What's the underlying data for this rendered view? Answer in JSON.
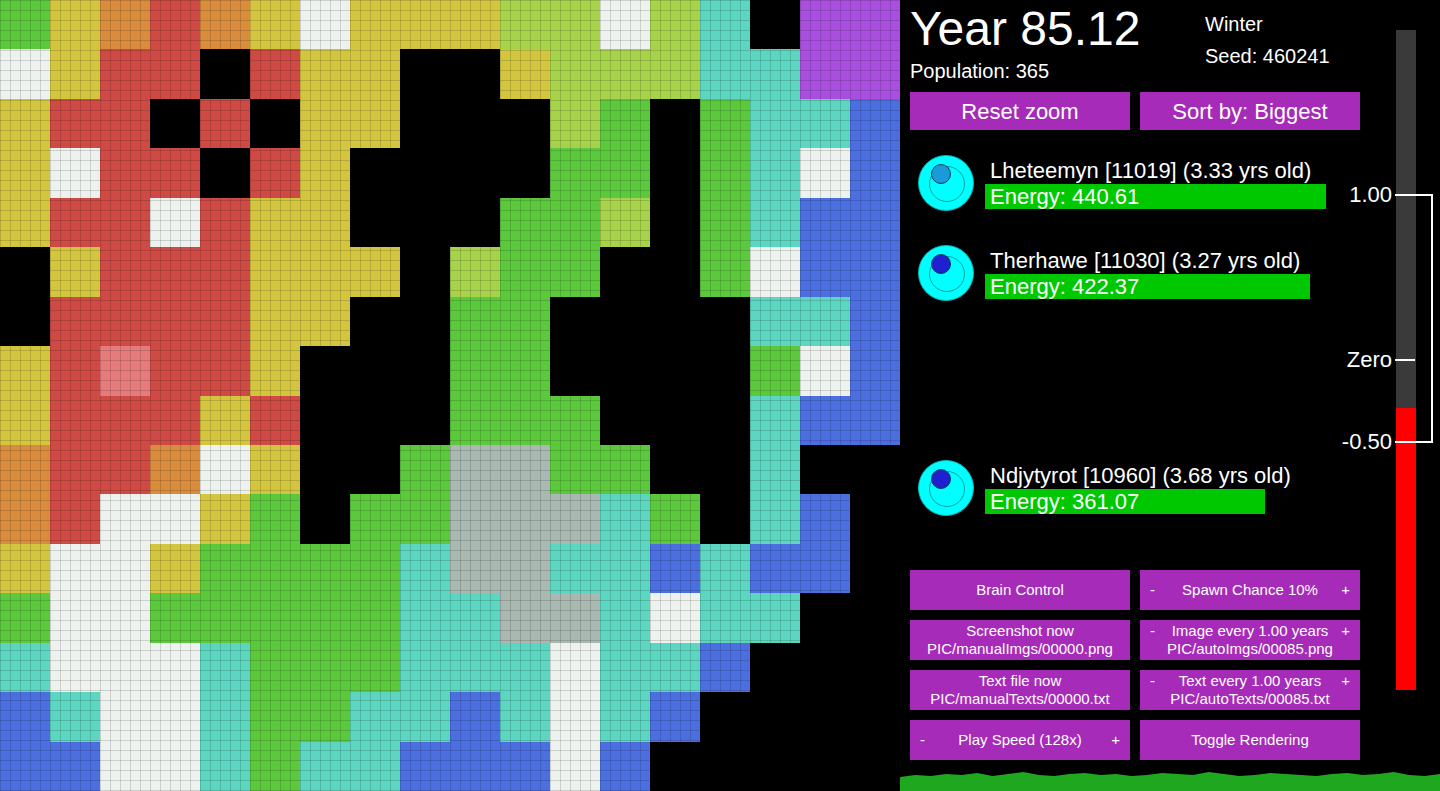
{
  "map": {
    "rows": [
      [
        "#5cc83c",
        "#d3c63e",
        "#d98c3c",
        "#cf4a44",
        "#d98c3c",
        "#d3c63e",
        "#eef2ee",
        "#d3c63e",
        "#d3c63e",
        "#d3c63e",
        "#a6d34a",
        "#a6d34a",
        "#eef2ee",
        "#a6d34a",
        "#5cd6c0",
        "#000000",
        "#a94fe0",
        "#a94fe0"
      ],
      [
        "#eef2ee",
        "#d3c63e",
        "#cf4a44",
        "#cf4a44",
        "#000000",
        "#cf4a44",
        "#d3c63e",
        "#d3c63e",
        "#000000",
        "#000000",
        "#d3c63e",
        "#a6d34a",
        "#a6d34a",
        "#a6d34a",
        "#5cd6c0",
        "#5cd6c0",
        "#a94fe0",
        "#a94fe0"
      ],
      [
        "#d3c63e",
        "#cf4a44",
        "#cf4a44",
        "#000000",
        "#cf4a44",
        "#000000",
        "#d3c63e",
        "#d3c63e",
        "#000000",
        "#000000",
        "#000000",
        "#a6d34a",
        "#5cc83c",
        "#000000",
        "#5cc83c",
        "#5cd6c0",
        "#5cd6c0",
        "#4c6fe0"
      ],
      [
        "#d3c63e",
        "#eef2ee",
        "#cf4a44",
        "#cf4a44",
        "#000000",
        "#cf4a44",
        "#d3c63e",
        "#000000",
        "#000000",
        "#000000",
        "#000000",
        "#5cc83c",
        "#5cc83c",
        "#000000",
        "#5cc83c",
        "#5cd6c0",
        "#eef2ee",
        "#4c6fe0"
      ],
      [
        "#d3c63e",
        "#cf4a44",
        "#cf4a44",
        "#eef2ee",
        "#cf4a44",
        "#d3c63e",
        "#d3c63e",
        "#000000",
        "#000000",
        "#000000",
        "#5cc83c",
        "#5cc83c",
        "#a6d34a",
        "#000000",
        "#5cc83c",
        "#5cd6c0",
        "#4c6fe0",
        "#4c6fe0"
      ],
      [
        "#000000",
        "#d3c63e",
        "#cf4a44",
        "#cf4a44",
        "#cf4a44",
        "#d3c63e",
        "#d3c63e",
        "#d3c63e",
        "#000000",
        "#a6d34a",
        "#5cc83c",
        "#5cc83c",
        "#000000",
        "#000000",
        "#5cc83c",
        "#eef2ee",
        "#4c6fe0",
        "#4c6fe0"
      ],
      [
        "#000000",
        "#cf4a44",
        "#cf4a44",
        "#cf4a44",
        "#cf4a44",
        "#d3c63e",
        "#d3c63e",
        "#000000",
        "#000000",
        "#5cc83c",
        "#5cc83c",
        "#000000",
        "#000000",
        "#000000",
        "#000000",
        "#5cd6c0",
        "#5cd6c0",
        "#4c6fe0"
      ],
      [
        "#d3c63e",
        "#cf4a44",
        "#e57b7b",
        "#cf4a44",
        "#cf4a44",
        "#d3c63e",
        "#000000",
        "#000000",
        "#000000",
        "#5cc83c",
        "#5cc83c",
        "#000000",
        "#000000",
        "#000000",
        "#000000",
        "#5cc83c",
        "#eef2ee",
        "#4c6fe0"
      ],
      [
        "#d3c63e",
        "#cf4a44",
        "#cf4a44",
        "#cf4a44",
        "#d3c63e",
        "#cf4a44",
        "#000000",
        "#000000",
        "#000000",
        "#5cc83c",
        "#5cc83c",
        "#5cc83c",
        "#000000",
        "#000000",
        "#000000",
        "#5cd6c0",
        "#4c6fe0",
        "#4c6fe0"
      ],
      [
        "#d98c3c",
        "#cf4a44",
        "#cf4a44",
        "#d98c3c",
        "#eef2ee",
        "#d3c63e",
        "#000000",
        "#000000",
        "#5cc83c",
        "#a9b8b0",
        "#a9b8b0",
        "#5cc83c",
        "#5cc83c",
        "#000000",
        "#000000",
        "#5cd6c0",
        "#000000",
        "#000000"
      ],
      [
        "#d98c3c",
        "#cf4a44",
        "#eef2ee",
        "#eef2ee",
        "#d3c63e",
        "#5cc83c",
        "#000000",
        "#5cc83c",
        "#5cc83c",
        "#a9b8b0",
        "#a9b8b0",
        "#a9b8b0",
        "#5cd6c0",
        "#5cc83c",
        "#000000",
        "#5cd6c0",
        "#4c6fe0",
        "#000000"
      ],
      [
        "#d3c63e",
        "#eef2ee",
        "#eef2ee",
        "#d3c63e",
        "#5cc83c",
        "#5cc83c",
        "#5cc83c",
        "#5cc83c",
        "#5cd6c0",
        "#a9b8b0",
        "#a9b8b0",
        "#5cd6c0",
        "#5cd6c0",
        "#4c6fe0",
        "#5cd6c0",
        "#4c6fe0",
        "#4c6fe0",
        "#000000"
      ],
      [
        "#5cc83c",
        "#eef2ee",
        "#eef2ee",
        "#5cc83c",
        "#5cc83c",
        "#5cc83c",
        "#5cc83c",
        "#5cc83c",
        "#5cd6c0",
        "#5cd6c0",
        "#a9b8b0",
        "#a9b8b0",
        "#5cd6c0",
        "#eef2ee",
        "#5cd6c0",
        "#5cd6c0",
        "#000000",
        "#000000"
      ],
      [
        "#5cd6c0",
        "#eef2ee",
        "#eef2ee",
        "#eef2ee",
        "#5cd6c0",
        "#5cc83c",
        "#5cc83c",
        "#5cc83c",
        "#5cd6c0",
        "#5cd6c0",
        "#5cd6c0",
        "#eef2ee",
        "#5cd6c0",
        "#5cd6c0",
        "#4c6fe0",
        "#000000",
        "#000000",
        "#000000"
      ],
      [
        "#4c6fe0",
        "#5cd6c0",
        "#eef2ee",
        "#eef2ee",
        "#5cd6c0",
        "#5cc83c",
        "#5cc83c",
        "#5cd6c0",
        "#5cd6c0",
        "#4c6fe0",
        "#5cd6c0",
        "#eef2ee",
        "#5cd6c0",
        "#4c6fe0",
        "#000000",
        "#000000",
        "#000000",
        "#000000"
      ],
      [
        "#4c6fe0",
        "#4c6fe0",
        "#eef2ee",
        "#eef2ee",
        "#5cd6c0",
        "#5cc83c",
        "#5cd6c0",
        "#5cd6c0",
        "#4c6fe0",
        "#4c6fe0",
        "#4c6fe0",
        "#eef2ee",
        "#4c6fe0",
        "#000000",
        "#000000",
        "#000000",
        "#000000",
        "#000000"
      ]
    ]
  },
  "header": {
    "year": "Year 85.12",
    "season": "Winter",
    "seed": "Seed: 460241",
    "population": "Population: 365"
  },
  "top_buttons": [
    "Reset zoom",
    "Sort by: Biggest"
  ],
  "creatures": [
    {
      "name": "Lheteemyn [11019] (3.33 yrs old)",
      "energy": "Energy: 440.61",
      "level": 0.96,
      "color": "#1a9ad8"
    },
    {
      "name": "Therhawe [11030] (3.27 yrs old)",
      "energy": "Energy: 422.37",
      "level": 0.915,
      "color": "#2020d0"
    },
    {
      "name": "Ndjytyrot [10960] (3.68 yrs old)",
      "energy": "Energy: 361.07",
      "level": 0.79,
      "color": "#2020d0"
    }
  ],
  "controls": [
    {
      "label": "Brain Control",
      "sub": "",
      "minus": "",
      "plus": ""
    },
    {
      "label": "Spawn Chance 10%",
      "sub": "",
      "minus": "-",
      "plus": "+"
    },
    {
      "label": "Screenshot now",
      "sub": "PIC/manualImgs/00000.png",
      "minus": "",
      "plus": ""
    },
    {
      "label": "Image every 1.00 years",
      "sub": "PIC/autoImgs/00085.png",
      "minus": "-",
      "plus": "+"
    },
    {
      "label": "Text file now",
      "sub": "PIC/manualTexts/00000.txt",
      "minus": "",
      "plus": ""
    },
    {
      "label": "Text every 1.00 years",
      "sub": "PIC/autoTexts/00085.txt",
      "minus": "-",
      "plus": "+"
    },
    {
      "label": "Play Speed (128x)",
      "sub": "",
      "minus": "-",
      "plus": "+"
    },
    {
      "label": "Toggle Rendering",
      "sub": "",
      "minus": "",
      "plus": ""
    }
  ],
  "meter": {
    "level": 0.427,
    "ticks": [
      {
        "label": "1.00",
        "level": 0.75,
        "bracket": true
      },
      {
        "label": "Zero",
        "level": 0.5,
        "bracket": false
      },
      {
        "label": "-0.50",
        "level": 0.376,
        "bracket": true
      }
    ]
  },
  "population_graph": {
    "values": [
      14,
      16,
      15,
      17,
      16,
      18,
      15,
      17,
      19,
      16,
      15,
      17,
      18,
      16,
      17,
      15,
      16,
      18,
      17,
      16,
      19,
      17,
      15,
      16,
      18,
      17,
      16,
      15,
      17,
      18,
      16,
      17,
      19,
      16,
      15,
      17
    ]
  }
}
